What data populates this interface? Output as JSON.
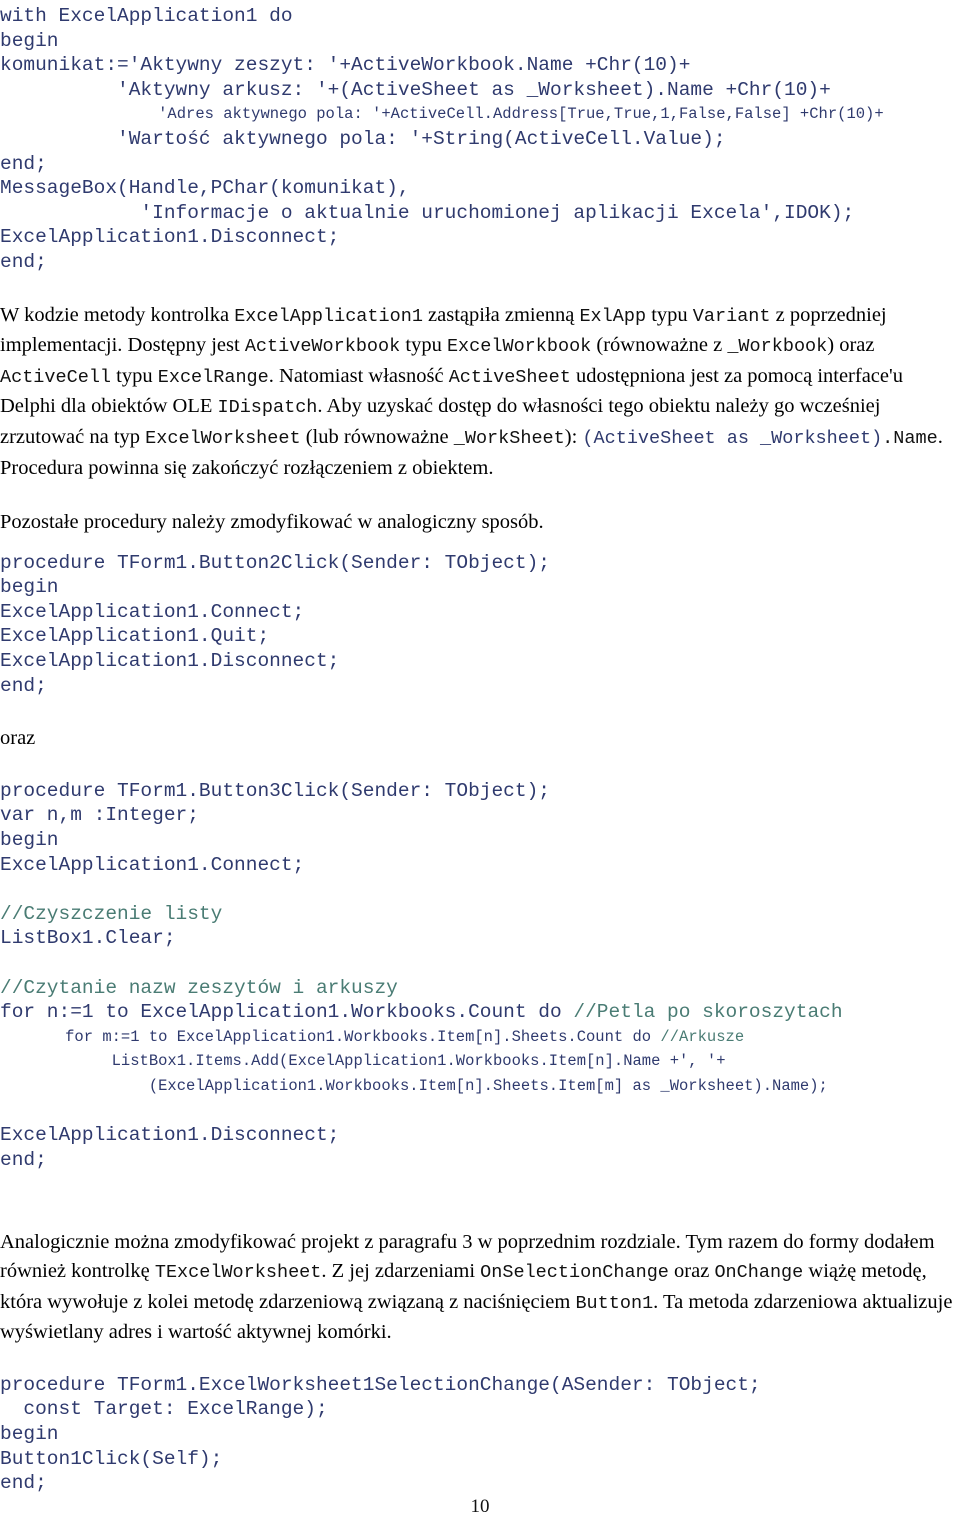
{
  "document": {
    "page_number": "10",
    "language": "pl",
    "colors": {
      "code": "#2f3a6e",
      "comment": "#4a7c74",
      "body_text": "#000000",
      "page_background": "#ffffff"
    }
  },
  "blocks": [
    {
      "id": "code-1",
      "type": "code",
      "lines": [
        {
          "text": "with ExcelApplication1 do",
          "size": "normal"
        },
        {
          "text": "begin",
          "size": "normal"
        },
        {
          "text": "komunikat:='Aktywny zeszyt: '+ActiveWorkbook.Name +Chr(10)+",
          "size": "normal"
        },
        {
          "text": "          'Aktywny arkusz: '+(ActiveSheet as _Worksheet).Name +Chr(10)+",
          "size": "normal"
        },
        {
          "text": "                 'Adres aktywnego pola: '+ActiveCell.Address[True,True,1,False,False] +Chr(10)+",
          "size": "small"
        },
        {
          "text": "          'Wartość aktywnego pola: '+String(ActiveCell.Value);",
          "size": "normal"
        },
        {
          "text": "end;",
          "size": "normal"
        },
        {
          "text": "MessageBox(Handle,PChar(komunikat),",
          "size": "normal"
        },
        {
          "text": "            'Informacje o aktualnie uruchomionej aplikacji Excela',IDOK);",
          "size": "normal"
        },
        {
          "text": "ExcelApplication1.Disconnect;",
          "size": "normal"
        },
        {
          "text": "end;",
          "size": "normal"
        }
      ]
    },
    {
      "id": "para-1",
      "type": "paragraph",
      "runs": [
        {
          "text": "W kodzie metody kontrolka ",
          "style": "serif"
        },
        {
          "text": "ExcelApplication1",
          "style": "mono"
        },
        {
          "text": " zastąpiła zmienną ",
          "style": "serif"
        },
        {
          "text": "ExlApp",
          "style": "mono"
        },
        {
          "text": " typu ",
          "style": "serif"
        },
        {
          "text": "Variant",
          "style": "mono"
        },
        {
          "text": " z poprzedniej implementacji. Dostępny jest ",
          "style": "serif"
        },
        {
          "text": "ActiveWorkbook",
          "style": "mono"
        },
        {
          "text": " typu ",
          "style": "serif"
        },
        {
          "text": "ExcelWorkbook",
          "style": "mono"
        },
        {
          "text": " (równoważne z ",
          "style": "serif"
        },
        {
          "text": "_Workbook",
          "style": "mono"
        },
        {
          "text": ") oraz ",
          "style": "serif"
        },
        {
          "text": "ActiveCell",
          "style": "mono"
        },
        {
          "text": " typu ",
          "style": "serif"
        },
        {
          "text": "ExcelRange",
          "style": "mono"
        },
        {
          "text": ". Natomiast własność ",
          "style": "serif"
        },
        {
          "text": "ActiveSheet",
          "style": "mono"
        },
        {
          "text": " udostępniona jest za pomocą interface'u Delphi dla obiektów OLE ",
          "style": "serif"
        },
        {
          "text": "IDispatch",
          "style": "mono"
        },
        {
          "text": ". Aby uzyskać dostęp do własności tego obiektu należy go wcześniej zrzutować na typ ",
          "style": "serif"
        },
        {
          "text": "ExcelWorksheet",
          "style": "mono"
        },
        {
          "text": " (lub równoważne ",
          "style": "serif"
        },
        {
          "text": "_WorkSheet",
          "style": "mono"
        },
        {
          "text": "): ",
          "style": "serif"
        },
        {
          "text": "(ActiveSheet as _Worksheet)",
          "style": "mono-blue"
        },
        {
          "text": ".Name",
          "style": "mono"
        },
        {
          "text": ". Procedura powinna się zakończyć rozłączeniem z obiektem.",
          "style": "serif"
        }
      ]
    },
    {
      "id": "para-2",
      "type": "paragraph",
      "runs": [
        {
          "text": "Pozostałe procedury należy zmodyfikować w analogiczny sposób.",
          "style": "serif"
        }
      ]
    },
    {
      "id": "code-2",
      "type": "code",
      "lines": [
        {
          "text": "procedure TForm1.Button2Click(Sender: TObject);",
          "size": "normal"
        },
        {
          "text": "begin",
          "size": "normal"
        },
        {
          "text": "ExcelApplication1.Connect;",
          "size": "normal"
        },
        {
          "text": "ExcelApplication1.Quit;",
          "size": "normal"
        },
        {
          "text": "ExcelApplication1.Disconnect;",
          "size": "normal"
        },
        {
          "text": "end;",
          "size": "normal"
        }
      ]
    },
    {
      "id": "para-3",
      "type": "paragraph",
      "runs": [
        {
          "text": "oraz",
          "style": "serif"
        }
      ]
    },
    {
      "id": "code-3",
      "type": "code",
      "lines": [
        {
          "text": "procedure TForm1.Button3Click(Sender: TObject);",
          "size": "normal"
        },
        {
          "text": "var n,m :Integer;",
          "size": "normal"
        },
        {
          "text": "begin",
          "size": "normal"
        },
        {
          "text": "ExcelApplication1.Connect;",
          "size": "normal"
        },
        {
          "text": "",
          "size": "blank"
        },
        {
          "text": "//Czyszczenie listy",
          "size": "normal",
          "comment": true
        },
        {
          "text": "ListBox1.Clear;",
          "size": "normal"
        },
        {
          "text": "",
          "size": "blank"
        },
        {
          "text": "//Czytanie nazw zeszytów i arkuszy",
          "size": "normal",
          "comment": true
        },
        {
          "code": "for n:=1 to ExcelApplication1.Workbooks.Count do ",
          "comment_tail": "//Petla po skoroszytach",
          "size": "normal"
        },
        {
          "code": "       for m:=1 to ExcelApplication1.Workbooks.Item[n].Sheets.Count do ",
          "comment_tail": "//Arkusze",
          "size": "small"
        },
        {
          "text": "            ListBox1.Items.Add(ExcelApplication1.Workbooks.Item[n].Name +', '+",
          "size": "small"
        },
        {
          "text": "                (ExcelApplication1.Workbooks.Item[n].Sheets.Item[m] as _Worksheet).Name);",
          "size": "small"
        },
        {
          "text": "",
          "size": "blank"
        },
        {
          "text": "ExcelApplication1.Disconnect;",
          "size": "normal"
        },
        {
          "text": "end;",
          "size": "normal"
        }
      ]
    },
    {
      "id": "para-4",
      "type": "paragraph",
      "runs": [
        {
          "text": "Analogicznie można zmodyfikować projekt z paragrafu 3 w poprzednim rozdziale. Tym razem do formy dodałem również kontrolkę ",
          "style": "serif"
        },
        {
          "text": "TExcelWorksheet",
          "style": "mono"
        },
        {
          "text": ". Z jej zdarzeniami ",
          "style": "serif"
        },
        {
          "text": "OnSelectionChange",
          "style": "mono"
        },
        {
          "text": " oraz ",
          "style": "serif"
        },
        {
          "text": "OnChange",
          "style": "mono"
        },
        {
          "text": " wiążę metodę, która wywołuje z kolei metodę zdarzeniową związaną z naciśnięciem ",
          "style": "serif"
        },
        {
          "text": "Button1",
          "style": "mono"
        },
        {
          "text": ". Ta metoda zdarzeniowa aktualizuje wyświetlany adres i wartość aktywnej komórki.",
          "style": "serif"
        }
      ]
    },
    {
      "id": "code-4",
      "type": "code",
      "lines": [
        {
          "text": "procedure TForm1.ExcelWorksheet1SelectionChange(ASender: TObject;",
          "size": "normal"
        },
        {
          "text": "  const Target: ExcelRange);",
          "size": "normal"
        },
        {
          "text": "begin",
          "size": "normal"
        },
        {
          "text": "Button1Click(Self);",
          "size": "normal"
        },
        {
          "text": "end;",
          "size": "normal"
        }
      ]
    }
  ]
}
